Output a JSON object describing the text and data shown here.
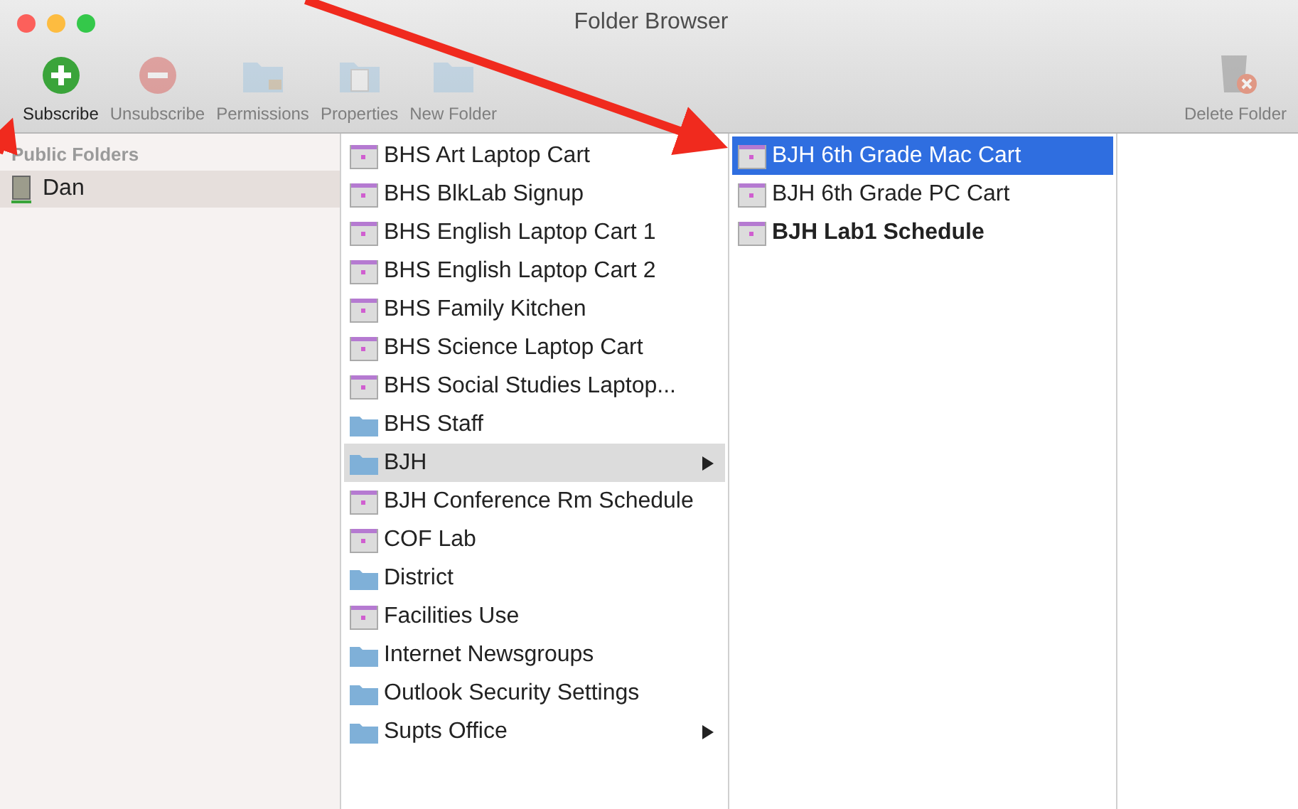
{
  "window": {
    "title": "Folder Browser"
  },
  "toolbar": [
    {
      "label": "Subscribe",
      "kind": "subscribe",
      "disabled": false
    },
    {
      "label": "Unsubscribe",
      "kind": "unsubscribe",
      "disabled": true
    },
    {
      "label": "Permissions",
      "kind": "permissions",
      "disabled": true
    },
    {
      "label": "Properties",
      "kind": "properties",
      "disabled": true
    },
    {
      "label": "New Folder",
      "kind": "new_folder",
      "disabled": true
    }
  ],
  "toolbar_right": {
    "label": "Delete Folder",
    "disabled": true
  },
  "sidebar": {
    "header": "Public Folders",
    "items": [
      {
        "label": "Dan",
        "selected": true
      }
    ]
  },
  "columns": [
    {
      "items": [
        {
          "label": "BHS Art Laptop Cart",
          "kind": "calendar",
          "has_children": false,
          "selected": false,
          "bold": false
        },
        {
          "label": "BHS BlkLab Signup",
          "kind": "calendar",
          "has_children": false,
          "selected": false,
          "bold": false
        },
        {
          "label": "BHS English Laptop Cart 1",
          "kind": "calendar",
          "has_children": false,
          "selected": false,
          "bold": false
        },
        {
          "label": "BHS English Laptop Cart 2",
          "kind": "calendar",
          "has_children": false,
          "selected": false,
          "bold": false
        },
        {
          "label": "BHS Family Kitchen",
          "kind": "calendar",
          "has_children": false,
          "selected": false,
          "bold": false
        },
        {
          "label": "BHS Science Laptop Cart",
          "kind": "calendar",
          "has_children": false,
          "selected": false,
          "bold": false
        },
        {
          "label": "BHS Social Studies Laptop...",
          "kind": "calendar",
          "has_children": false,
          "selected": false,
          "bold": false
        },
        {
          "label": "BHS Staff",
          "kind": "folder",
          "has_children": false,
          "selected": false,
          "bold": false
        },
        {
          "label": "BJH",
          "kind": "folder",
          "has_children": true,
          "selected": true,
          "bold": false
        },
        {
          "label": "BJH Conference Rm Schedule",
          "kind": "calendar",
          "has_children": false,
          "selected": false,
          "bold": false
        },
        {
          "label": "COF Lab",
          "kind": "calendar",
          "has_children": false,
          "selected": false,
          "bold": false
        },
        {
          "label": "District",
          "kind": "folder",
          "has_children": false,
          "selected": false,
          "bold": false
        },
        {
          "label": "Facilities Use",
          "kind": "calendar",
          "has_children": false,
          "selected": false,
          "bold": false
        },
        {
          "label": "Internet Newsgroups",
          "kind": "folder",
          "has_children": false,
          "selected": false,
          "bold": false
        },
        {
          "label": "Outlook Security Settings",
          "kind": "folder",
          "has_children": false,
          "selected": false,
          "bold": false
        },
        {
          "label": "Supts Office",
          "kind": "folder",
          "has_children": true,
          "selected": false,
          "bold": false
        }
      ]
    },
    {
      "items": [
        {
          "label": "BJH 6th Grade Mac Cart",
          "kind": "calendar",
          "has_children": false,
          "selected": true,
          "bold": false
        },
        {
          "label": "BJH 6th Grade PC Cart",
          "kind": "calendar",
          "has_children": false,
          "selected": false,
          "bold": false
        },
        {
          "label": "BJH Lab1 Schedule",
          "kind": "calendar",
          "has_children": false,
          "selected": false,
          "bold": true
        }
      ]
    }
  ]
}
